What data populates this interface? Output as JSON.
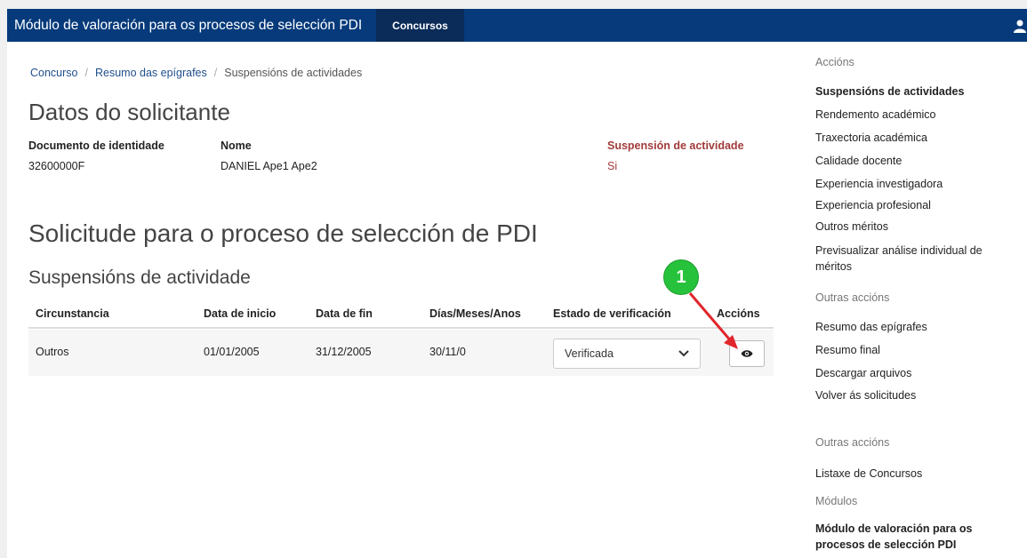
{
  "navbar": {
    "brand": "Módulo de valoración para os procesos de selección PDI",
    "tab": "Concursos"
  },
  "breadcrumb": {
    "items": [
      "Concurso",
      "Resumo das epígrafes"
    ],
    "current": "Suspensións de actividades"
  },
  "applicant": {
    "title": "Datos do solicitante",
    "id_label": "Documento de identidade",
    "id_value": "32600000F",
    "name_label": "Nome",
    "name_value": "DANIEL Ape1 Ape2",
    "susp_label": "Suspensión de actividade",
    "susp_value": "Si"
  },
  "request": {
    "title": "Solicitude para o proceso de selección de PDI",
    "section_title": "Suspensións de actividade",
    "columns": [
      "Circunstancia",
      "Data de inicio",
      "Data de fin",
      "Días/Meses/Anos",
      "Estado de verificación",
      "Accións"
    ],
    "rows": [
      {
        "circunstancia": "Outros",
        "inicio": "01/01/2005",
        "fin": "31/12/2005",
        "dias": "30/11/0",
        "estado": "Verificada"
      }
    ]
  },
  "annotation": {
    "badge": "1"
  },
  "sidebar": {
    "acciones_head": "Accións",
    "acciones": [
      "Suspensións de actividades",
      "Rendemento académico",
      "Traxectoria académica",
      "Calidade docente",
      "Experiencia investigadora",
      "Experiencia profesional",
      "Outros méritos",
      "Previsualizar análise individual de méritos"
    ],
    "outras_head_1": "Outras accións",
    "outras_1": [
      "Resumo das epígrafes",
      "Resumo final",
      "Descargar arquivos",
      "Volver ás solicitudes"
    ],
    "outras_head_2": "Outras accións",
    "outras_2": [
      "Listaxe de Concursos"
    ],
    "modulos_head": "Módulos",
    "modulos": [
      "Módulo de valoración para os procesos de selección PDI"
    ]
  },
  "colors": {
    "navbar": "#063a7a",
    "navtab": "#0b2c59",
    "link": "#1f4e8c",
    "suspension": "#a23b3b",
    "badge": "#27c23b",
    "arrow": "#e0252b"
  }
}
